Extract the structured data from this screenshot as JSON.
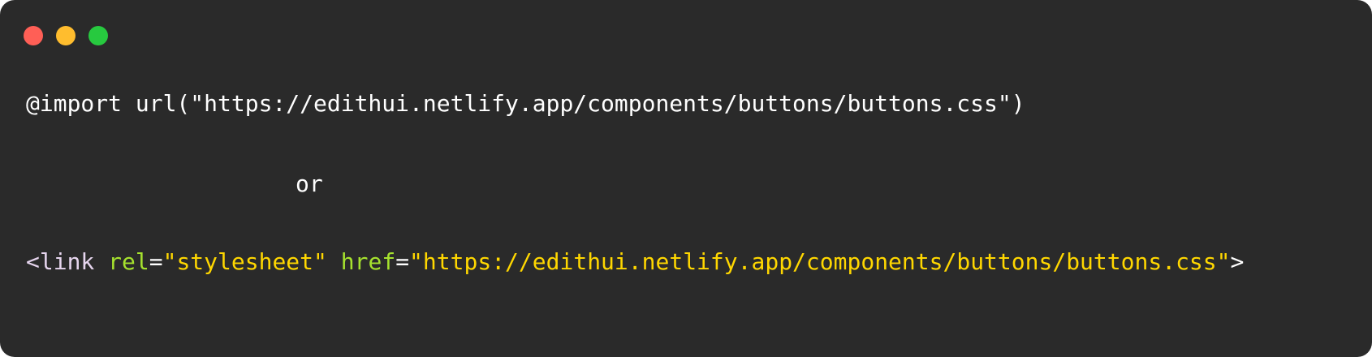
{
  "window": {
    "controls": [
      {
        "name": "close-button",
        "color": "#ff5f56"
      },
      {
        "name": "minimize-button",
        "color": "#ffbd2e"
      },
      {
        "name": "maximize-button",
        "color": "#27c93f"
      }
    ]
  },
  "code": {
    "line1": {
      "text": "@import url(\"https://edithui.netlify.app/components/buttons/buttons.css\")",
      "color": "#ffffff"
    },
    "line2": {
      "text": "or",
      "color": "#ffffff"
    },
    "line3": {
      "tokens": [
        {
          "text": "<link",
          "color": "#e6d5ee"
        },
        {
          "text": " ",
          "color": "#ffffff"
        },
        {
          "text": "rel",
          "color": "#a6e22e"
        },
        {
          "text": "=",
          "color": "#ffffff"
        },
        {
          "text": "\"stylesheet\"",
          "color": "#ffd700"
        },
        {
          "text": " ",
          "color": "#ffffff"
        },
        {
          "text": "href",
          "color": "#a6e22e"
        },
        {
          "text": "=",
          "color": "#ffffff"
        },
        {
          "text": "\"https://edithui.netlify.app/components/buttons/buttons.css\"",
          "color": "#ffd700"
        },
        {
          "text": ">",
          "color": "#ffffff"
        }
      ]
    }
  }
}
